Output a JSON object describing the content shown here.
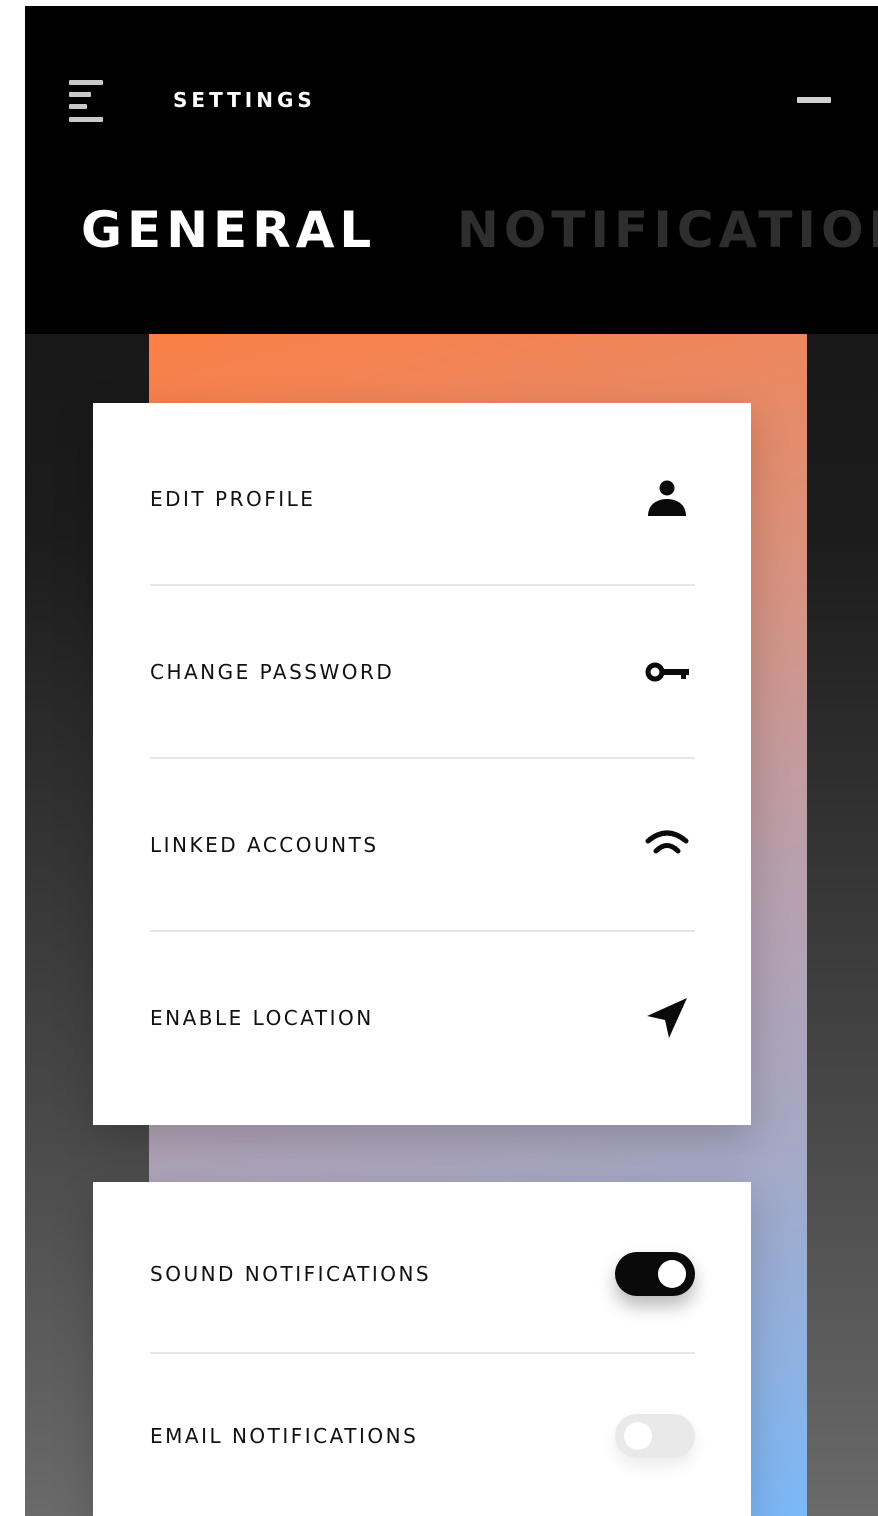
{
  "header": {
    "title": "SETTINGS",
    "menu_icon": "hamburger-menu-icon",
    "minimize_icon": "minimize-icon"
  },
  "tabs": [
    {
      "label": "GENERAL",
      "active": true
    },
    {
      "label": "NOTIFICATIONS",
      "active": false
    }
  ],
  "general": {
    "items": [
      {
        "label": "EDIT PROFILE",
        "icon": "person-icon"
      },
      {
        "label": "CHANGE PASSWORD",
        "icon": "key-icon"
      },
      {
        "label": "LINKED ACCOUNTS",
        "icon": "wifi-icon"
      },
      {
        "label": "ENABLE LOCATION",
        "icon": "location-arrow-icon"
      }
    ]
  },
  "notifications": {
    "items": [
      {
        "label": "SOUND NOTIFICATIONS",
        "enabled": true
      },
      {
        "label": "EMAIL NOTIFICATIONS",
        "enabled": false
      }
    ]
  },
  "colors": {
    "header_bg": "#000000",
    "active_tab": "#ffffff",
    "inactive_tab": "#2e2e2e",
    "gradient_top": "#fb7f45",
    "gradient_bottom": "#7bb8f8",
    "toggle_on": "#0a0a0a",
    "toggle_off": "#e9e9e9"
  }
}
